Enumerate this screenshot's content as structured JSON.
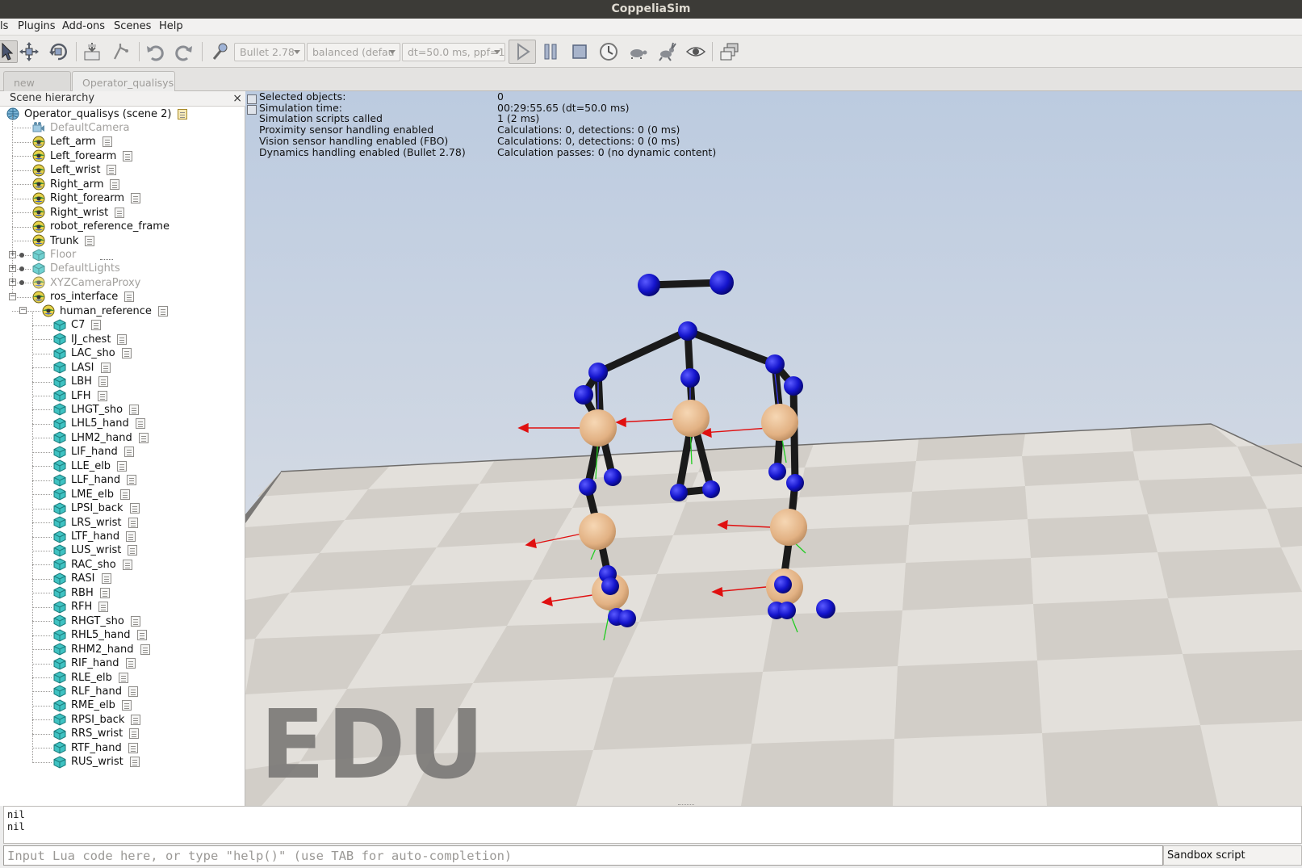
{
  "window": {
    "title": "CoppeliaSim"
  },
  "menu": [
    "ls",
    "Plugins",
    "Add-ons",
    "Scenes",
    "Help"
  ],
  "toolbar": {
    "engine": "Bullet 2.78",
    "accuracy": "balanced (defau",
    "timestep": "dt=50.0 ms, ppf=1"
  },
  "tabs": [
    {
      "label": "new scene",
      "active": false
    },
    {
      "label": "Operator_qualisys",
      "active": true
    }
  ],
  "hierarchy": {
    "title": "Scene hierarchy",
    "close": "×",
    "root": "Operator_qualisys (scene 2)",
    "items": [
      {
        "label": "DefaultCamera",
        "icon": "camera-icon",
        "dim": true,
        "script": false,
        "level": 1
      },
      {
        "label": "Left_arm",
        "icon": "dummy-icon",
        "dim": false,
        "script": true,
        "level": 1
      },
      {
        "label": "Left_forearm",
        "icon": "dummy-icon",
        "dim": false,
        "script": true,
        "level": 1
      },
      {
        "label": "Left_wrist",
        "icon": "dummy-icon",
        "dim": false,
        "script": true,
        "level": 1
      },
      {
        "label": "Right_arm",
        "icon": "dummy-icon",
        "dim": false,
        "script": true,
        "level": 1
      },
      {
        "label": "Right_forearm",
        "icon": "dummy-icon",
        "dim": false,
        "script": true,
        "level": 1
      },
      {
        "label": "Right_wrist",
        "icon": "dummy-icon",
        "dim": false,
        "script": true,
        "level": 1
      },
      {
        "label": "robot_reference_frame",
        "icon": "dummy-icon",
        "dim": false,
        "script": false,
        "level": 1
      },
      {
        "label": "Trunk",
        "icon": "dummy-icon",
        "dim": false,
        "script": true,
        "level": 1
      },
      {
        "label": "Floor",
        "icon": "shape-icon",
        "dim": true,
        "script": false,
        "level": 1,
        "expand": "+"
      },
      {
        "label": "DefaultLights",
        "icon": "shape-icon",
        "dim": true,
        "script": false,
        "level": 1,
        "expand": "+"
      },
      {
        "label": "XYZCameraProxy",
        "icon": "dummy-icon",
        "dim": true,
        "script": false,
        "level": 1,
        "expand": "+"
      },
      {
        "label": "ros_interface",
        "icon": "dummy-icon",
        "dim": false,
        "script": true,
        "level": 1,
        "expand": "-"
      },
      {
        "label": "human_reference",
        "icon": "dummy-icon",
        "dim": false,
        "script": true,
        "level": 2,
        "expand": "-"
      },
      {
        "label": "C7",
        "icon": "shape-icon",
        "dim": false,
        "script": true,
        "level": 3
      },
      {
        "label": "IJ_chest",
        "icon": "shape-icon",
        "dim": false,
        "script": true,
        "level": 3
      },
      {
        "label": "LAC_sho",
        "icon": "shape-icon",
        "dim": false,
        "script": true,
        "level": 3
      },
      {
        "label": "LASI",
        "icon": "shape-icon",
        "dim": false,
        "script": true,
        "level": 3
      },
      {
        "label": "LBH",
        "icon": "shape-icon",
        "dim": false,
        "script": true,
        "level": 3
      },
      {
        "label": "LFH",
        "icon": "shape-icon",
        "dim": false,
        "script": true,
        "level": 3
      },
      {
        "label": "LHGT_sho",
        "icon": "shape-icon",
        "dim": false,
        "script": true,
        "level": 3
      },
      {
        "label": "LHL5_hand",
        "icon": "shape-icon",
        "dim": false,
        "script": true,
        "level": 3
      },
      {
        "label": "LHM2_hand",
        "icon": "shape-icon",
        "dim": false,
        "script": true,
        "level": 3
      },
      {
        "label": "LIF_hand",
        "icon": "shape-icon",
        "dim": false,
        "script": true,
        "level": 3
      },
      {
        "label": "LLE_elb",
        "icon": "shape-icon",
        "dim": false,
        "script": true,
        "level": 3
      },
      {
        "label": "LLF_hand",
        "icon": "shape-icon",
        "dim": false,
        "script": true,
        "level": 3
      },
      {
        "label": "LME_elb",
        "icon": "shape-icon",
        "dim": false,
        "script": true,
        "level": 3
      },
      {
        "label": "LPSI_back",
        "icon": "shape-icon",
        "dim": false,
        "script": true,
        "level": 3
      },
      {
        "label": "LRS_wrist",
        "icon": "shape-icon",
        "dim": false,
        "script": true,
        "level": 3
      },
      {
        "label": "LTF_hand",
        "icon": "shape-icon",
        "dim": false,
        "script": true,
        "level": 3
      },
      {
        "label": "LUS_wrist",
        "icon": "shape-icon",
        "dim": false,
        "script": true,
        "level": 3
      },
      {
        "label": "RAC_sho",
        "icon": "shape-icon",
        "dim": false,
        "script": true,
        "level": 3
      },
      {
        "label": "RASI",
        "icon": "shape-icon",
        "dim": false,
        "script": true,
        "level": 3
      },
      {
        "label": "RBH",
        "icon": "shape-icon",
        "dim": false,
        "script": true,
        "level": 3
      },
      {
        "label": "RFH",
        "icon": "shape-icon",
        "dim": false,
        "script": true,
        "level": 3
      },
      {
        "label": "RHGT_sho",
        "icon": "shape-icon",
        "dim": false,
        "script": true,
        "level": 3
      },
      {
        "label": "RHL5_hand",
        "icon": "shape-icon",
        "dim": false,
        "script": true,
        "level": 3
      },
      {
        "label": "RHM2_hand",
        "icon": "shape-icon",
        "dim": false,
        "script": true,
        "level": 3
      },
      {
        "label": "RIF_hand",
        "icon": "shape-icon",
        "dim": false,
        "script": true,
        "level": 3
      },
      {
        "label": "RLE_elb",
        "icon": "shape-icon",
        "dim": false,
        "script": true,
        "level": 3
      },
      {
        "label": "RLF_hand",
        "icon": "shape-icon",
        "dim": false,
        "script": true,
        "level": 3
      },
      {
        "label": "RME_elb",
        "icon": "shape-icon",
        "dim": false,
        "script": true,
        "level": 3
      },
      {
        "label": "RPSI_back",
        "icon": "shape-icon",
        "dim": false,
        "script": true,
        "level": 3
      },
      {
        "label": "RRS_wrist",
        "icon": "shape-icon",
        "dim": false,
        "script": true,
        "level": 3
      },
      {
        "label": "RTF_hand",
        "icon": "shape-icon",
        "dim": false,
        "script": true,
        "level": 3
      },
      {
        "label": "RUS_wrist",
        "icon": "shape-icon",
        "dim": false,
        "script": true,
        "level": 3
      }
    ]
  },
  "info": [
    {
      "label": "Selected objects:",
      "value": "0"
    },
    {
      "label": "Simulation time:",
      "value": "00:29:55.65 (dt=50.0 ms)"
    },
    {
      "label": "Simulation scripts called",
      "value": "1 (2 ms)"
    },
    {
      "label": "Proximity sensor handling enabled",
      "value": "Calculations: 0, detections: 0 (0 ms)"
    },
    {
      "label": "Vision sensor handling enabled (FBO)",
      "value": "Calculations: 0, detections: 0 (0 ms)"
    },
    {
      "label": "Dynamics handling enabled (Bullet 2.78)",
      "value": "Calculation passes: 0 (no dynamic content)"
    }
  ],
  "watermark": "EDU",
  "console": {
    "lines": [
      "nil",
      "nil"
    ]
  },
  "lua": {
    "placeholder": "Input Lua code here, or type \"help()\" (use TAB for auto-completion)"
  },
  "sandbox": {
    "label": "Sandbox script"
  },
  "colors": {
    "marker": "#1010cc",
    "link": "#1a1a1a",
    "joint": "#e8b889",
    "arrow": "#e01010",
    "axis_green": "#22cc22"
  }
}
